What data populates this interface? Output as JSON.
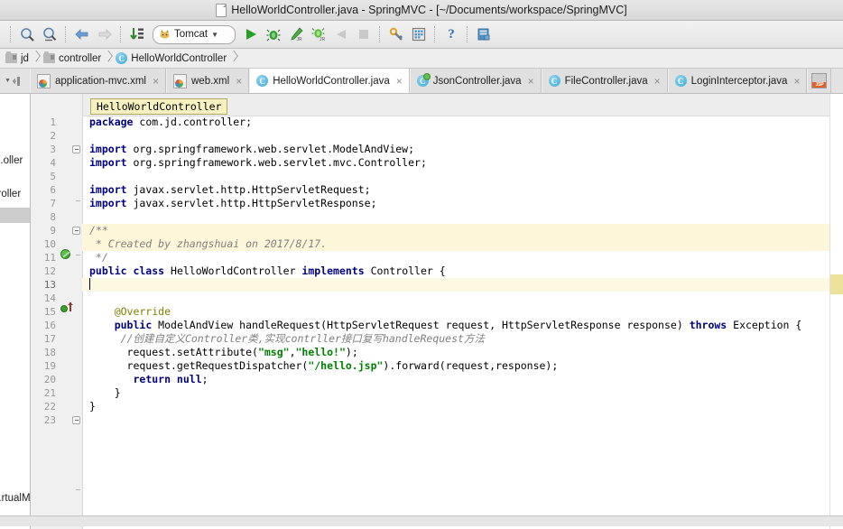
{
  "window": {
    "title": "HelloWorldController.java - SpringMVC - [~/Documents/workspace/SpringMVC]",
    "doc_icon": "document-icon"
  },
  "toolbar": {
    "buttons": [
      {
        "name": "search-everywhere-icon",
        "label": "",
        "tooltip": "Search"
      },
      {
        "name": "find-in-path-icon",
        "label": "",
        "tooltip": "Find in Path"
      },
      {
        "name": "navigate-back-icon",
        "label": "",
        "tooltip": "Back"
      },
      {
        "name": "navigate-forward-icon",
        "label": "",
        "tooltip": "Forward"
      },
      {
        "name": "sort-icon",
        "label": "",
        "tooltip": "Sort"
      }
    ],
    "run_configuration": {
      "label": "Tomcat",
      "icon": "tomcat-cat-icon",
      "dropdown": "chevron-down-icon"
    },
    "actions": [
      {
        "name": "run-icon",
        "tooltip": "Run"
      },
      {
        "name": "debug-icon",
        "tooltip": "Debug"
      },
      {
        "name": "run-coverage-icon",
        "tooltip": "Run with Coverage"
      },
      {
        "name": "debug-jr-icon",
        "tooltip": "Rerun"
      },
      {
        "name": "update-app-icon",
        "tooltip": "Update Application"
      },
      {
        "name": "stop-icon",
        "tooltip": "Stop"
      },
      {
        "name": "settings-wrench-icon",
        "tooltip": "Settings"
      },
      {
        "name": "project-structure-icon",
        "tooltip": "Project Structure"
      },
      {
        "name": "help-icon",
        "tooltip": "Help"
      },
      {
        "name": "database-icon",
        "tooltip": "Database"
      }
    ]
  },
  "breadcrumb": {
    "items": [
      {
        "label": "jd",
        "icon": "folder-icon"
      },
      {
        "label": "controller",
        "icon": "folder-icon"
      },
      {
        "label": "HelloWorldController",
        "icon": "java-class-icon"
      }
    ]
  },
  "tabs": {
    "left_controls": [
      {
        "name": "tab-chevron-icon"
      },
      {
        "name": "tab-pin-icon"
      }
    ],
    "items": [
      {
        "label": "application-mvc.xml",
        "icon": "xml-file-icon",
        "active": false,
        "close": "×"
      },
      {
        "label": "web.xml",
        "icon": "xml-file-icon",
        "active": false,
        "close": "×"
      },
      {
        "label": "HelloWorldController.java",
        "icon": "java-class-icon",
        "active": true,
        "close": "×"
      },
      {
        "label": "JsonController.java",
        "icon": "java-class-icon-run",
        "active": false,
        "close": "×"
      },
      {
        "label": "FileController.java",
        "icon": "java-class-icon",
        "active": false,
        "close": "×"
      },
      {
        "label": "LoginInterceptor.java",
        "icon": "java-class-icon",
        "active": false,
        "close": "×"
      },
      {
        "label": "",
        "icon": "jsp-file-icon",
        "active": false,
        "close": ""
      }
    ]
  },
  "left_panel": {
    "rows": [
      {
        "text": "...oller",
        "selected": false
      },
      {
        "text": "...roller",
        "selected": false
      },
      {
        "text": "",
        "selected": true
      },
      {
        "text": "...rtualM",
        "selected": false
      }
    ]
  },
  "editor": {
    "sticky_class": "HelloWorldController",
    "caret_line": 13,
    "lines": [
      {
        "n": 1,
        "tokens": [
          {
            "t": "package",
            "c": "kw"
          },
          {
            "t": " com.jd.controller;",
            "c": "plain"
          }
        ],
        "hl": ""
      },
      {
        "n": 2,
        "tokens": [],
        "hl": ""
      },
      {
        "n": 3,
        "tokens": [
          {
            "t": "import",
            "c": "kw"
          },
          {
            "t": " org.springframework.web.servlet.ModelAndView;",
            "c": "plain"
          }
        ],
        "hl": ""
      },
      {
        "n": 4,
        "tokens": [
          {
            "t": "import",
            "c": "kw"
          },
          {
            "t": " org.springframework.web.servlet.mvc.Controller;",
            "c": "plain"
          }
        ],
        "hl": ""
      },
      {
        "n": 5,
        "tokens": [],
        "hl": ""
      },
      {
        "n": 6,
        "tokens": [
          {
            "t": "import",
            "c": "kw"
          },
          {
            "t": " javax.servlet.http.HttpServletRequest;",
            "c": "plain"
          }
        ],
        "hl": ""
      },
      {
        "n": 7,
        "tokens": [
          {
            "t": "import",
            "c": "kw"
          },
          {
            "t": " javax.servlet.http.HttpServletResponse;",
            "c": "plain"
          }
        ],
        "hl": ""
      },
      {
        "n": 8,
        "tokens": [],
        "hl": ""
      },
      {
        "n": 9,
        "tokens": [
          {
            "t": "/**",
            "c": "jdoc"
          }
        ],
        "hl": "hl-yellow"
      },
      {
        "n": 10,
        "tokens": [
          {
            "t": " * Created by zhangshuai on 2017/8/17.",
            "c": "jdoc"
          }
        ],
        "hl": "hl-yellow"
      },
      {
        "n": 11,
        "tokens": [
          {
            "t": " */",
            "c": "jdoc"
          }
        ],
        "hl": ""
      },
      {
        "n": 12,
        "tokens": [
          {
            "t": "public class",
            "c": "kw"
          },
          {
            "t": " HelloWorldController ",
            "c": "plain"
          },
          {
            "t": "implements",
            "c": "kw"
          },
          {
            "t": " Controller {",
            "c": "plain"
          }
        ],
        "hl": ""
      },
      {
        "n": 13,
        "tokens": [],
        "hl": "hl-caret",
        "caret": true
      },
      {
        "n": 14,
        "tokens": [],
        "hl": ""
      },
      {
        "n": 15,
        "tokens": [
          {
            "t": "    @Override",
            "c": "anno"
          }
        ],
        "hl": ""
      },
      {
        "n": 16,
        "tokens": [
          {
            "t": "    ",
            "c": "plain"
          },
          {
            "t": "public",
            "c": "kw"
          },
          {
            "t": " ModelAndView handleRequest(HttpServletRequest request, HttpServletResponse response) ",
            "c": "plain"
          },
          {
            "t": "throws",
            "c": "kw"
          },
          {
            "t": " Exception {",
            "c": "plain"
          }
        ],
        "hl": ""
      },
      {
        "n": 17,
        "tokens": [
          {
            "t": "     //创建自定义Controller类,实现contrller接口复写handleRequest方法",
            "c": "cmt"
          }
        ],
        "hl": ""
      },
      {
        "n": 18,
        "tokens": [
          {
            "t": "      request.setAttribute(",
            "c": "plain"
          },
          {
            "t": "\"msg\"",
            "c": "str"
          },
          {
            "t": ",",
            "c": "plain"
          },
          {
            "t": "\"hello!\"",
            "c": "str"
          },
          {
            "t": ");",
            "c": "plain"
          }
        ],
        "hl": ""
      },
      {
        "n": 19,
        "tokens": [
          {
            "t": "      request.getRequestDispatcher(",
            "c": "plain"
          },
          {
            "t": "\"/hello.jsp\"",
            "c": "str"
          },
          {
            "t": ").forward(request,response);",
            "c": "plain"
          }
        ],
        "hl": ""
      },
      {
        "n": 20,
        "tokens": [
          {
            "t": "       ",
            "c": "plain"
          },
          {
            "t": "return null",
            "c": "kw"
          },
          {
            "t": ";",
            "c": "plain"
          }
        ],
        "hl": ""
      },
      {
        "n": 21,
        "tokens": [
          {
            "t": "    }",
            "c": "plain"
          }
        ],
        "hl": ""
      },
      {
        "n": 22,
        "tokens": [
          {
            "t": "}",
            "c": "plain"
          }
        ],
        "hl": ""
      },
      {
        "n": 23,
        "tokens": [],
        "hl": ""
      }
    ],
    "gutter_markers": [
      {
        "line": 12,
        "name": "implemented-interface-marker",
        "type": "green-ball"
      },
      {
        "line": 16,
        "name": "overriding-method-marker",
        "type": "green-small-arrow"
      }
    ]
  }
}
